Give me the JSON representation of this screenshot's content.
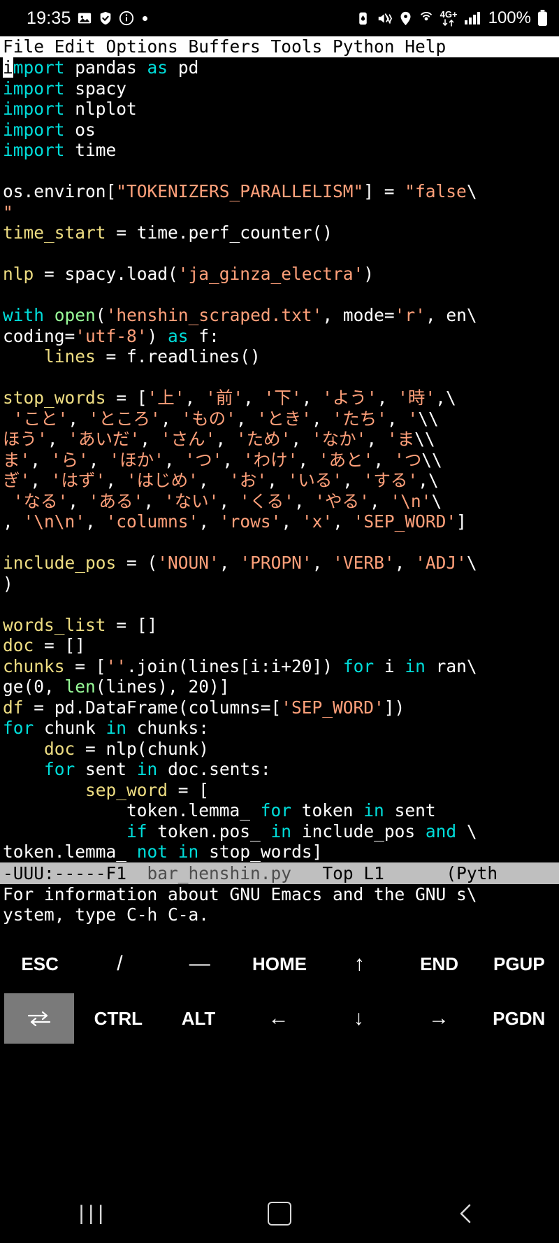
{
  "status_bar": {
    "clock": "19:35",
    "left_icons": [
      "photo-icon",
      "shield-check-icon",
      "info-circle-icon",
      "dot-indicator"
    ],
    "right_icons": [
      "data-saver-icon",
      "mute-vibrate-icon",
      "location-icon",
      "hotspot-icon",
      "mobile-data-arrows-icon",
      "signal-bars-icon"
    ],
    "network_label": "4G+",
    "battery_text": "100%"
  },
  "emacs": {
    "menubar": "File Edit Options Buffers Tools Python Help",
    "buffer_lines": [
      {
        "id": "l1",
        "segments": [
          {
            "t": "i",
            "c": "cursor"
          },
          {
            "t": "mport",
            "c": "kw"
          },
          {
            "t": " pandas ",
            "c": "pl"
          },
          {
            "t": "as",
            "c": "kw"
          },
          {
            "t": " pd",
            "c": "pl"
          }
        ]
      },
      {
        "id": "l2",
        "segments": [
          {
            "t": "import",
            "c": "kw"
          },
          {
            "t": " spacy",
            "c": "pl"
          }
        ]
      },
      {
        "id": "l3",
        "segments": [
          {
            "t": "import",
            "c": "kw"
          },
          {
            "t": " nlplot",
            "c": "pl"
          }
        ]
      },
      {
        "id": "l4",
        "segments": [
          {
            "t": "import",
            "c": "kw"
          },
          {
            "t": " os",
            "c": "pl"
          }
        ]
      },
      {
        "id": "l5",
        "segments": [
          {
            "t": "import",
            "c": "kw"
          },
          {
            "t": " time",
            "c": "pl"
          }
        ]
      },
      {
        "id": "l6",
        "segments": [
          {
            "t": "",
            "c": "pl"
          }
        ]
      },
      {
        "id": "l7",
        "segments": [
          {
            "t": "os.environ[",
            "c": "pl"
          },
          {
            "t": "\"TOKENIZERS_PARALLELISM\"",
            "c": "str"
          },
          {
            "t": "] = ",
            "c": "pl"
          },
          {
            "t": "\"false",
            "c": "str"
          },
          {
            "t": "\\",
            "c": "cont"
          }
        ]
      },
      {
        "id": "l8",
        "segments": [
          {
            "t": "\"",
            "c": "str"
          }
        ]
      },
      {
        "id": "l9",
        "segments": [
          {
            "t": "time_start",
            "c": "var"
          },
          {
            "t": " = time.perf_counter()",
            "c": "pl"
          }
        ]
      },
      {
        "id": "l10",
        "segments": [
          {
            "t": "",
            "c": "pl"
          }
        ]
      },
      {
        "id": "l11",
        "segments": [
          {
            "t": "nlp",
            "c": "var"
          },
          {
            "t": " = spacy.load(",
            "c": "pl"
          },
          {
            "t": "'ja_ginza_electra'",
            "c": "str"
          },
          {
            "t": ")",
            "c": "pl"
          }
        ]
      },
      {
        "id": "l12",
        "segments": [
          {
            "t": "",
            "c": "pl"
          }
        ]
      },
      {
        "id": "l13",
        "segments": [
          {
            "t": "with",
            "c": "kw"
          },
          {
            "t": " ",
            "c": "pl"
          },
          {
            "t": "open",
            "c": "bi"
          },
          {
            "t": "(",
            "c": "pl"
          },
          {
            "t": "'henshin_scraped.txt'",
            "c": "str"
          },
          {
            "t": ", mode=",
            "c": "pl"
          },
          {
            "t": "'r'",
            "c": "str"
          },
          {
            "t": ", en",
            "c": "pl"
          },
          {
            "t": "\\",
            "c": "cont"
          }
        ]
      },
      {
        "id": "l14",
        "segments": [
          {
            "t": "coding=",
            "c": "pl"
          },
          {
            "t": "'utf-8'",
            "c": "str"
          },
          {
            "t": ") ",
            "c": "pl"
          },
          {
            "t": "as",
            "c": "kw"
          },
          {
            "t": " f:",
            "c": "pl"
          }
        ]
      },
      {
        "id": "l15",
        "segments": [
          {
            "t": "    ",
            "c": "pl"
          },
          {
            "t": "lines",
            "c": "var"
          },
          {
            "t": " = f.readlines()",
            "c": "pl"
          }
        ]
      },
      {
        "id": "l16",
        "segments": [
          {
            "t": "",
            "c": "pl"
          }
        ]
      },
      {
        "id": "l17",
        "segments": [
          {
            "t": "stop_words",
            "c": "var"
          },
          {
            "t": " = [",
            "c": "pl"
          },
          {
            "t": "'上'",
            "c": "str"
          },
          {
            "t": ", ",
            "c": "pl"
          },
          {
            "t": "'前'",
            "c": "str"
          },
          {
            "t": ", ",
            "c": "pl"
          },
          {
            "t": "'下'",
            "c": "str"
          },
          {
            "t": ", ",
            "c": "pl"
          },
          {
            "t": "'よう'",
            "c": "str"
          },
          {
            "t": ", ",
            "c": "pl"
          },
          {
            "t": "'時'",
            "c": "str"
          },
          {
            "t": ",",
            "c": "pl"
          },
          {
            "t": "\\",
            "c": "cont"
          }
        ]
      },
      {
        "id": "l18",
        "segments": [
          {
            "t": " ",
            "c": "pl"
          },
          {
            "t": "'こと'",
            "c": "str"
          },
          {
            "t": ", ",
            "c": "pl"
          },
          {
            "t": "'ところ'",
            "c": "str"
          },
          {
            "t": ", ",
            "c": "pl"
          },
          {
            "t": "'もの'",
            "c": "str"
          },
          {
            "t": ", ",
            "c": "pl"
          },
          {
            "t": "'とき'",
            "c": "str"
          },
          {
            "t": ", ",
            "c": "pl"
          },
          {
            "t": "'たち'",
            "c": "str"
          },
          {
            "t": ", ",
            "c": "pl"
          },
          {
            "t": "'",
            "c": "str"
          },
          {
            "t": "\\\\",
            "c": "cont"
          }
        ]
      },
      {
        "id": "l19",
        "segments": [
          {
            "t": "ほう'",
            "c": "str"
          },
          {
            "t": ", ",
            "c": "pl"
          },
          {
            "t": "'あいだ'",
            "c": "str"
          },
          {
            "t": ", ",
            "c": "pl"
          },
          {
            "t": "'さん'",
            "c": "str"
          },
          {
            "t": ", ",
            "c": "pl"
          },
          {
            "t": "'ため'",
            "c": "str"
          },
          {
            "t": ", ",
            "c": "pl"
          },
          {
            "t": "'なか'",
            "c": "str"
          },
          {
            "t": ", ",
            "c": "pl"
          },
          {
            "t": "'ま",
            "c": "str"
          },
          {
            "t": "\\\\",
            "c": "cont"
          }
        ]
      },
      {
        "id": "l20",
        "segments": [
          {
            "t": "ま'",
            "c": "str"
          },
          {
            "t": ", ",
            "c": "pl"
          },
          {
            "t": "'ら'",
            "c": "str"
          },
          {
            "t": ", ",
            "c": "pl"
          },
          {
            "t": "'ほか'",
            "c": "str"
          },
          {
            "t": ", ",
            "c": "pl"
          },
          {
            "t": "'つ'",
            "c": "str"
          },
          {
            "t": ", ",
            "c": "pl"
          },
          {
            "t": "'わけ'",
            "c": "str"
          },
          {
            "t": ", ",
            "c": "pl"
          },
          {
            "t": "'あと'",
            "c": "str"
          },
          {
            "t": ", ",
            "c": "pl"
          },
          {
            "t": "'つ",
            "c": "str"
          },
          {
            "t": "\\\\",
            "c": "cont"
          }
        ]
      },
      {
        "id": "l21",
        "segments": [
          {
            "t": "ぎ'",
            "c": "str"
          },
          {
            "t": ", ",
            "c": "pl"
          },
          {
            "t": "'はず'",
            "c": "str"
          },
          {
            "t": ", ",
            "c": "pl"
          },
          {
            "t": "'はじめ'",
            "c": "str"
          },
          {
            "t": ",  ",
            "c": "pl"
          },
          {
            "t": "'お'",
            "c": "str"
          },
          {
            "t": ", ",
            "c": "pl"
          },
          {
            "t": "'いる'",
            "c": "str"
          },
          {
            "t": ", ",
            "c": "pl"
          },
          {
            "t": "'する'",
            "c": "str"
          },
          {
            "t": ",",
            "c": "pl"
          },
          {
            "t": "\\",
            "c": "cont"
          }
        ]
      },
      {
        "id": "l22",
        "segments": [
          {
            "t": " ",
            "c": "pl"
          },
          {
            "t": "'なる'",
            "c": "str"
          },
          {
            "t": ", ",
            "c": "pl"
          },
          {
            "t": "'ある'",
            "c": "str"
          },
          {
            "t": ", ",
            "c": "pl"
          },
          {
            "t": "'ない'",
            "c": "str"
          },
          {
            "t": ", ",
            "c": "pl"
          },
          {
            "t": "'くる'",
            "c": "str"
          },
          {
            "t": ", ",
            "c": "pl"
          },
          {
            "t": "'やる'",
            "c": "str"
          },
          {
            "t": ", ",
            "c": "pl"
          },
          {
            "t": "'\\n'",
            "c": "str"
          },
          {
            "t": "\\",
            "c": "cont"
          }
        ]
      },
      {
        "id": "l23",
        "segments": [
          {
            "t": ", ",
            "c": "pl"
          },
          {
            "t": "'\\n\\n'",
            "c": "str"
          },
          {
            "t": ", ",
            "c": "pl"
          },
          {
            "t": "'columns'",
            "c": "str"
          },
          {
            "t": ", ",
            "c": "pl"
          },
          {
            "t": "'rows'",
            "c": "str"
          },
          {
            "t": ", ",
            "c": "pl"
          },
          {
            "t": "'x'",
            "c": "str"
          },
          {
            "t": ", ",
            "c": "pl"
          },
          {
            "t": "'SEP_WORD'",
            "c": "str"
          },
          {
            "t": "]",
            "c": "pl"
          }
        ]
      },
      {
        "id": "l24",
        "segments": [
          {
            "t": "",
            "c": "pl"
          }
        ]
      },
      {
        "id": "l25",
        "segments": [
          {
            "t": "include_pos",
            "c": "var"
          },
          {
            "t": " = (",
            "c": "pl"
          },
          {
            "t": "'NOUN'",
            "c": "str"
          },
          {
            "t": ", ",
            "c": "pl"
          },
          {
            "t": "'PROPN'",
            "c": "str"
          },
          {
            "t": ", ",
            "c": "pl"
          },
          {
            "t": "'VERB'",
            "c": "str"
          },
          {
            "t": ", ",
            "c": "pl"
          },
          {
            "t": "'ADJ'",
            "c": "str"
          },
          {
            "t": "\\",
            "c": "cont"
          }
        ]
      },
      {
        "id": "l26",
        "segments": [
          {
            "t": ")",
            "c": "pl"
          }
        ]
      },
      {
        "id": "l27",
        "segments": [
          {
            "t": "",
            "c": "pl"
          }
        ]
      },
      {
        "id": "l28",
        "segments": [
          {
            "t": "words_list",
            "c": "var"
          },
          {
            "t": " = []",
            "c": "pl"
          }
        ]
      },
      {
        "id": "l29",
        "segments": [
          {
            "t": "doc",
            "c": "var"
          },
          {
            "t": " = []",
            "c": "pl"
          }
        ]
      },
      {
        "id": "l30",
        "segments": [
          {
            "t": "chunks",
            "c": "var"
          },
          {
            "t": " = [",
            "c": "pl"
          },
          {
            "t": "''",
            "c": "str"
          },
          {
            "t": ".join(lines[i:i+20]) ",
            "c": "pl"
          },
          {
            "t": "for",
            "c": "kw"
          },
          {
            "t": " i ",
            "c": "pl"
          },
          {
            "t": "in",
            "c": "kw"
          },
          {
            "t": " ran",
            "c": "pl"
          },
          {
            "t": "\\",
            "c": "cont"
          }
        ]
      },
      {
        "id": "l31",
        "segments": [
          {
            "t": "ge(0, ",
            "c": "pl"
          },
          {
            "t": "len",
            "c": "bi"
          },
          {
            "t": "(lines), 20)]",
            "c": "pl"
          }
        ]
      },
      {
        "id": "l32",
        "segments": [
          {
            "t": "df",
            "c": "var"
          },
          {
            "t": " = pd.DataFrame(columns=[",
            "c": "pl"
          },
          {
            "t": "'SEP_WORD'",
            "c": "str"
          },
          {
            "t": "])",
            "c": "pl"
          }
        ]
      },
      {
        "id": "l33",
        "segments": [
          {
            "t": "for",
            "c": "kw"
          },
          {
            "t": " chunk ",
            "c": "pl"
          },
          {
            "t": "in",
            "c": "kw"
          },
          {
            "t": " chunks:",
            "c": "pl"
          }
        ]
      },
      {
        "id": "l34",
        "segments": [
          {
            "t": "    ",
            "c": "pl"
          },
          {
            "t": "doc",
            "c": "var"
          },
          {
            "t": " = nlp(chunk)",
            "c": "pl"
          }
        ]
      },
      {
        "id": "l35",
        "segments": [
          {
            "t": "    ",
            "c": "pl"
          },
          {
            "t": "for",
            "c": "kw"
          },
          {
            "t": " sent ",
            "c": "pl"
          },
          {
            "t": "in",
            "c": "kw"
          },
          {
            "t": " doc.sents:",
            "c": "pl"
          }
        ]
      },
      {
        "id": "l36",
        "segments": [
          {
            "t": "        ",
            "c": "pl"
          },
          {
            "t": "sep_word",
            "c": "var"
          },
          {
            "t": " = [",
            "c": "pl"
          }
        ]
      },
      {
        "id": "l37",
        "segments": [
          {
            "t": "            token.lemma_ ",
            "c": "pl"
          },
          {
            "t": "for",
            "c": "kw"
          },
          {
            "t": " token ",
            "c": "pl"
          },
          {
            "t": "in",
            "c": "kw"
          },
          {
            "t": " sent",
            "c": "pl"
          }
        ]
      },
      {
        "id": "l38",
        "segments": [
          {
            "t": "            ",
            "c": "pl"
          },
          {
            "t": "if",
            "c": "kw"
          },
          {
            "t": " token.pos_ ",
            "c": "pl"
          },
          {
            "t": "in",
            "c": "kw"
          },
          {
            "t": " include_pos ",
            "c": "pl"
          },
          {
            "t": "and",
            "c": "kw"
          },
          {
            "t": " ",
            "c": "pl"
          },
          {
            "t": "\\",
            "c": "cont"
          }
        ]
      },
      {
        "id": "l39",
        "segments": [
          {
            "t": "token.lemma_ ",
            "c": "pl"
          },
          {
            "t": "not",
            "c": "kw"
          },
          {
            "t": " ",
            "c": "pl"
          },
          {
            "t": "in",
            "c": "kw"
          },
          {
            "t": " stop_words]",
            "c": "pl"
          }
        ]
      }
    ],
    "modeline": {
      "prefix": "-UUU:-----F1",
      "buffer_name": "bar_henshin.py",
      "position": "Top L1",
      "mode": "(Pyth"
    },
    "echo_lines": [
      "For information about GNU Emacs and the GNU s\\",
      "ystem, type C-h C-a."
    ]
  },
  "keyboard": {
    "row1": [
      "ESC",
      "/",
      "—",
      "HOME",
      "↑",
      "END",
      "PGUP"
    ],
    "row2_tab_icon": "tab-key-icon",
    "row2": [
      "CTRL",
      "ALT",
      "←",
      "↓",
      "→",
      "PGDN"
    ]
  },
  "navbar": {
    "recents": "|||",
    "home": "home-square-icon",
    "back": "back-chevron-icon"
  }
}
